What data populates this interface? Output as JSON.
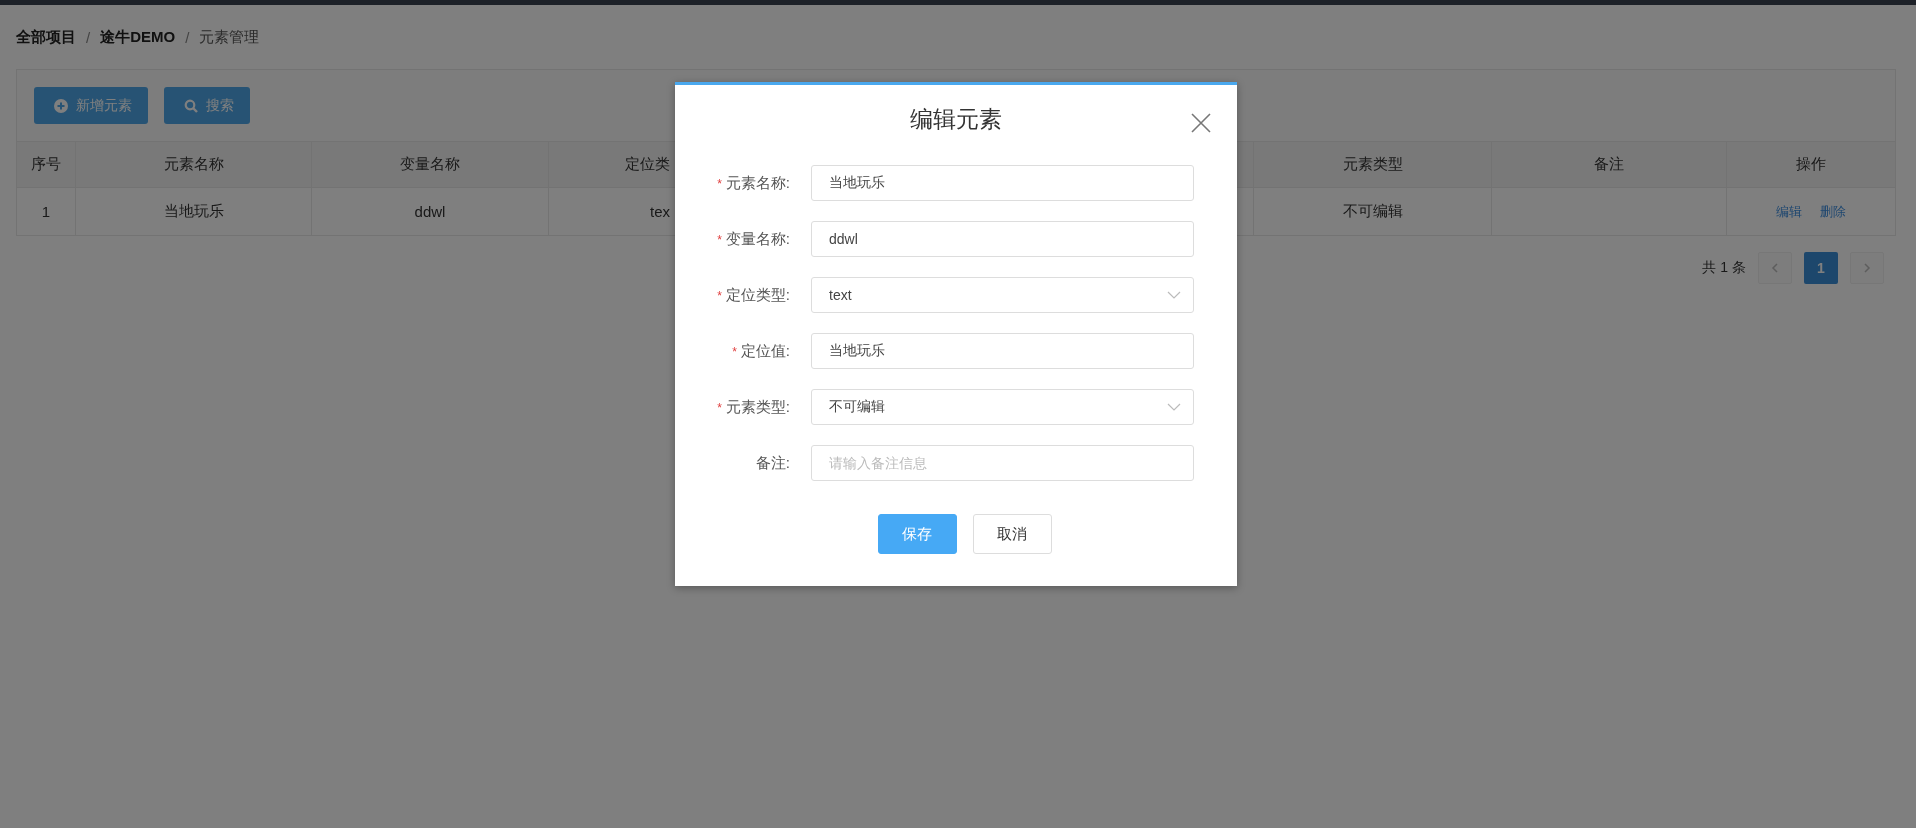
{
  "breadcrumb": {
    "separator": "/",
    "items": [
      {
        "label": "全部项目",
        "current": false
      },
      {
        "label": "途牛DEMO",
        "current": false
      },
      {
        "label": "元素管理",
        "current": true
      }
    ]
  },
  "toolbar": {
    "buttons": [
      {
        "label": "新增元素",
        "kind": "add"
      },
      {
        "label": "搜索",
        "kind": "search"
      }
    ]
  },
  "table": {
    "columns": [
      "序号",
      "元素名称",
      "变量名称",
      "定位类",
      "元素类型",
      "备注",
      "操作"
    ],
    "rows": [
      {
        "index": "1",
        "element_name": "当地玩乐",
        "variable_name": "ddwl",
        "locate_type": "tex",
        "element_type": "不可编辑",
        "actions": [
          "编辑",
          "删除"
        ]
      }
    ]
  },
  "pagination": {
    "total": "共 1 条",
    "pages": [
      {
        "label": "1",
        "selected": true
      }
    ]
  },
  "dialog": {
    "title": "编辑元素",
    "required_mark": "*",
    "fields": [
      {
        "label": "元素名称:",
        "required": true,
        "kind": "input",
        "value": "当地玩乐"
      },
      {
        "label": "变量名称:",
        "required": true,
        "kind": "input",
        "value": "ddwl"
      },
      {
        "label": "定位类型:",
        "required": true,
        "kind": "select",
        "value": "text"
      },
      {
        "label": "定位值:",
        "required": true,
        "kind": "input",
        "value": "当地玩乐"
      },
      {
        "label": "元素类型:",
        "required": true,
        "kind": "select",
        "value": "不可编辑"
      },
      {
        "label": "备注:",
        "required": false,
        "kind": "input",
        "placeholder": "请输入备注信息"
      }
    ],
    "buttons": [
      {
        "label": "保存",
        "kind": "primary"
      },
      {
        "label": "取消",
        "kind": "default"
      }
    ]
  }
}
